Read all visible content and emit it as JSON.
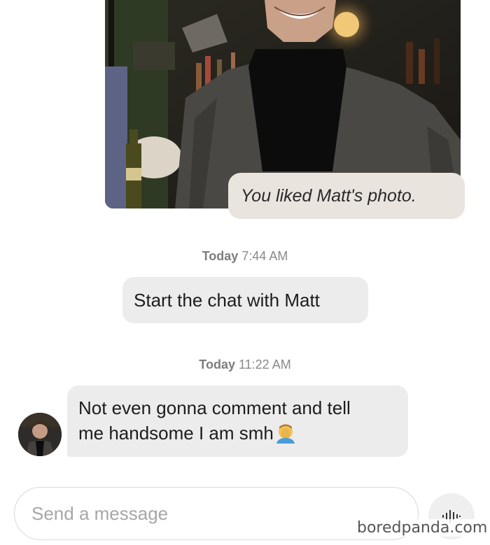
{
  "photo": {
    "liked_text": "You liked Matt's photo."
  },
  "messages": [
    {
      "timestamp_day": "Today",
      "timestamp_time": "7:44 AM",
      "text": "Start the chat with Matt"
    },
    {
      "timestamp_day": "Today",
      "timestamp_time": "11:22 AM",
      "text_line1": "Not even gonna comment and tell",
      "text_line2": "me handsome I am smh",
      "emoji": "face-palm-emoji"
    }
  ],
  "composer": {
    "placeholder": "Send a message",
    "voice_icon": "waveform-icon"
  },
  "watermark": "boredpanda.com",
  "colors": {
    "liked_bubble": "#eae4df",
    "chat_bubble": "#ececec",
    "timestamp": "#8a8a8a"
  }
}
